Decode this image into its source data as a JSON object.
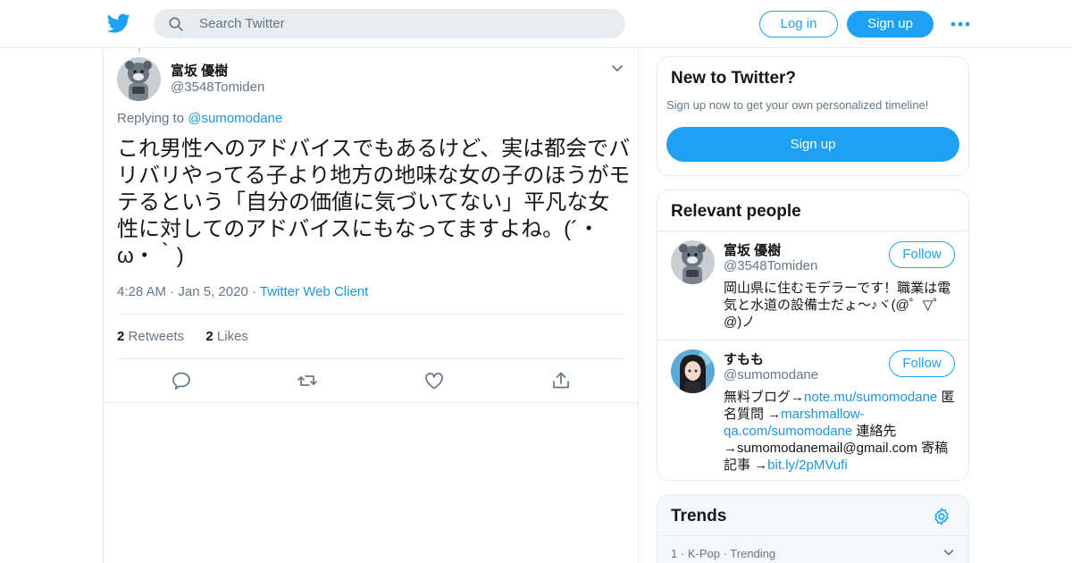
{
  "header": {
    "search_placeholder": "Search Twitter",
    "login_label": "Log in",
    "signup_label": "Sign up",
    "brand_color": "#1da1f2"
  },
  "tweet": {
    "author_name": "富坂 優樹",
    "author_handle": "@3548Tomiden",
    "replying_prefix": "Replying to ",
    "replying_to": "@sumomodane",
    "text": "これ男性へのアドバイスでもあるけど、実は都会でバリバリやってる子より地方の地味な女の子のほうがモテるという「自分の価値に気づいてない」平凡な女性に対してのアドバイスにもなってますよね。(´・ω・｀)",
    "time": "4:28 AM",
    "date": "Jan 5, 2020",
    "client": "Twitter Web Client",
    "retweets_count": "2",
    "retweets_label": "Retweets",
    "likes_count": "2",
    "likes_label": "Likes",
    "actions": [
      "reply-icon",
      "retweet-icon",
      "like-icon",
      "share-icon"
    ]
  },
  "sidebar": {
    "new_card": {
      "title": "New to Twitter?",
      "subtitle": "Sign up now to get your own personalized timeline!",
      "signup_label": "Sign up"
    },
    "relevant": {
      "title": "Relevant people",
      "people": [
        {
          "name": "富坂 優樹",
          "handle": "@3548Tomiden",
          "follow_label": "Follow",
          "bio": "岡山県に住むモデラーです！職業は電気と水道の設備士だょ～♪ヾ(@゜▽゜@)ノ"
        },
        {
          "name": "すもも",
          "handle": "@sumomodane",
          "follow_label": "Follow",
          "bio_1": "無料ブログ→",
          "bio_link_1": "note.mu/sumomodane",
          "bio_2": " 匿名質問 →",
          "bio_link_2": "marshmallow-qa.com/sumomodane",
          "bio_3": " 連絡先 →sumomodanemail@gmail.com 寄稿記事 →",
          "bio_link_3": "bit.ly/2pMVufi"
        }
      ]
    },
    "trends": {
      "title": "Trends",
      "first_rank": "1",
      "first_category": "K-Pop",
      "first_status": "Trending"
    }
  }
}
